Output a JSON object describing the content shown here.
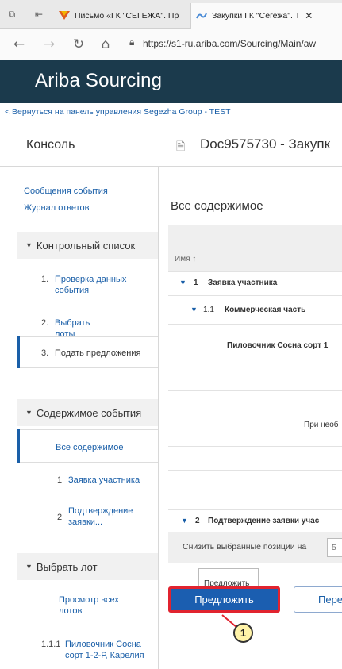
{
  "browser": {
    "tabs": [
      {
        "label": "Письмо «ГК \"СЕГЕЖА\". Пр",
        "active": false
      },
      {
        "label": "Закупки ГК \"Сегежа\". Т",
        "active": true
      }
    ],
    "address": "https://s1-ru.ariba.com/Sourcing/Main/aw"
  },
  "app": {
    "title": "Ariba Sourcing",
    "back_link": "< Вернуться на панель управления Segezha Group - TEST"
  },
  "page": {
    "console_title": "Консоль",
    "doc_title": "Doc9575730 - Закупк"
  },
  "sidebar": {
    "links": [
      "Сообщения события",
      "Журнал ответов"
    ],
    "checklist": {
      "title": "Контрольный список",
      "steps": [
        {
          "num": "1.",
          "label": "Проверка данных события"
        },
        {
          "num": "2.",
          "label": "Выбрать лоты"
        },
        {
          "num": "3.",
          "label": "Подать предложения"
        }
      ]
    },
    "event_contents": {
      "title": "Содержимое события",
      "items": [
        {
          "num": "",
          "label": "Все содержимое"
        },
        {
          "num": "1",
          "label": "Заявка участника"
        },
        {
          "num": "2",
          "label": "Подтверждение заявки..."
        }
      ]
    },
    "select_lot": {
      "title": "Выбрать лот",
      "items": [
        {
          "num": "",
          "label": "Просмотр всех лотов"
        },
        {
          "num": "1.1.1",
          "label": "Пиловочник Сосна сорт 1-2-Р, Карелия"
        }
      ]
    }
  },
  "main": {
    "heading": "Все содержимое",
    "column_name": "Имя ↑",
    "rows": [
      {
        "num": "1",
        "label": "Заявка участника"
      },
      {
        "num": "1.1",
        "label": "Коммерческая часть"
      },
      {
        "num": "",
        "label": "Пиловочник Сосна сорт 1"
      },
      {
        "num": "",
        "label": "При необ"
      },
      {
        "num": "2",
        "label": "Подтверждение заявки учас"
      }
    ],
    "filter_label": "Снизить выбранные позиции на",
    "filter_value": "5",
    "tooltip": "Предложить",
    "submit_button": "Предложить",
    "secondary_button": "Пере",
    "callout_number": "1"
  },
  "colors": {
    "header_bg": "#1b3a4c",
    "primary_button": "#1b5eb0",
    "highlight_border": "#e1232f",
    "link": "#1a5fa8"
  }
}
